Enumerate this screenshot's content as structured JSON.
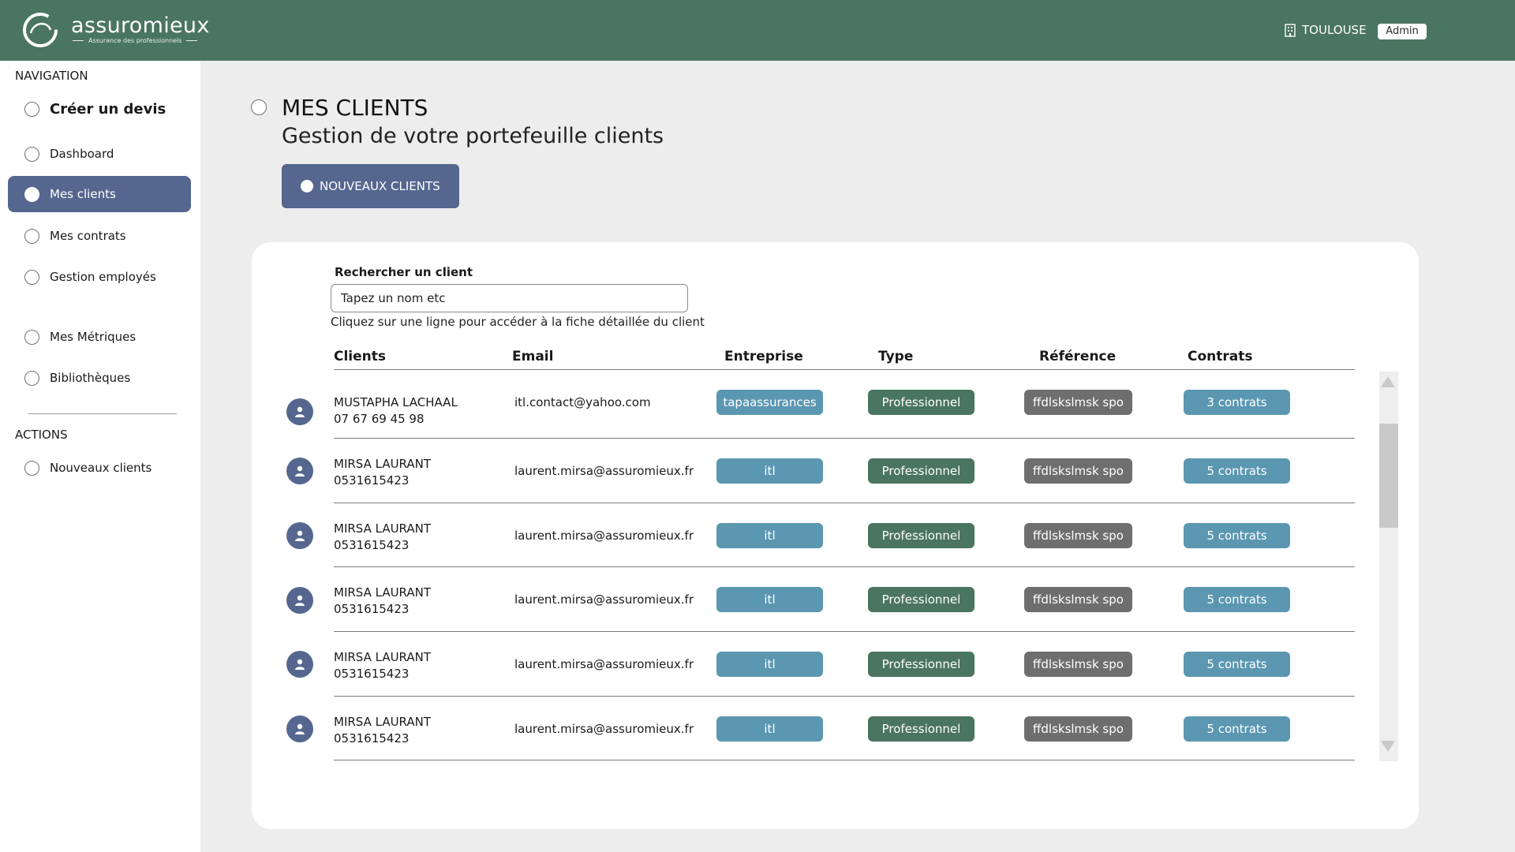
{
  "header": {
    "brand": "assuromieux",
    "tagline": "Assurance des professionnels",
    "city": "TOULOUSE",
    "role": "Admin"
  },
  "sidebar": {
    "nav_title": "NAVIGATION",
    "nav_items": [
      {
        "label": "Créer un devis"
      },
      {
        "label": "Dashboard"
      },
      {
        "label": "Mes clients",
        "active": true
      },
      {
        "label": "Mes contrats"
      },
      {
        "label": "Gestion employés"
      },
      {
        "label": "Mes Métriques"
      },
      {
        "label": "Bibliothèques"
      }
    ],
    "actions_title": "ACTIONS",
    "action_items": [
      {
        "label": "Nouveaux clients"
      }
    ]
  },
  "main": {
    "title": "MES CLIENTS",
    "subtitle": "Gestion de votre portefeuille clients",
    "primary_button": "NOUVEAUX CLIENTS",
    "search": {
      "label": "Rechercher un client",
      "placeholder": "Tapez un nom etc",
      "hint": "Cliquez sur une ligne pour accéder à la fiche détaillée du client"
    },
    "columns": [
      "Clients",
      "Email",
      "Entreprise",
      "Type",
      "Référence",
      "Contrats"
    ],
    "rows": [
      {
        "name": "MUSTAPHA LACHAAL",
        "phone": "07 67 69 45 98",
        "email": "itl.contact@yahoo.com",
        "company": "tapaassurances",
        "type": "Professionnel",
        "reference": "ffdlskslmsk spo",
        "contracts": "3 contrats"
      },
      {
        "name": "MIRSA LAURANT",
        "phone": "0531615423",
        "email": "laurent.mirsa@assuromieux.fr",
        "company": "itl",
        "type": "Professionnel",
        "reference": "ffdlskslmsk spo",
        "contracts": "5 contrats"
      },
      {
        "name": "MIRSA LAURANT",
        "phone": "0531615423",
        "email": "laurent.mirsa@assuromieux.fr",
        "company": "itl",
        "type": "Professionnel",
        "reference": "ffdlskslmsk spo",
        "contracts": "5 contrats"
      },
      {
        "name": "MIRSA LAURANT",
        "phone": "0531615423",
        "email": "laurent.mirsa@assuromieux.fr",
        "company": "itl",
        "type": "Professionnel",
        "reference": "ffdlskslmsk spo",
        "contracts": "5 contrats"
      },
      {
        "name": "MIRSA LAURANT",
        "phone": "0531615423",
        "email": "laurent.mirsa@assuromieux.fr",
        "company": "itl",
        "type": "Professionnel",
        "reference": "ffdlskslmsk spo",
        "contracts": "5 contrats"
      },
      {
        "name": "MIRSA LAURANT",
        "phone": "0531615423",
        "email": "laurent.mirsa@assuromieux.fr",
        "company": "itl",
        "type": "Professionnel",
        "reference": "ffdlskslmsk spo",
        "contracts": "5 contrats"
      }
    ]
  },
  "icons": {
    "logo": "swirl-logo-icon",
    "city": "building-icon",
    "avatar": "user-avatar-icon",
    "nav": "radio-circle-icon",
    "scroll_up": "arrow-up-icon",
    "scroll_down": "arrow-down-icon"
  },
  "colors": {
    "header_green": "#4a7560",
    "primary_blue": "#55678f",
    "company_blue": "#5b97b1",
    "type_green": "#4a7560",
    "reference_gray": "#6e6e6e",
    "background": "#ededed"
  }
}
